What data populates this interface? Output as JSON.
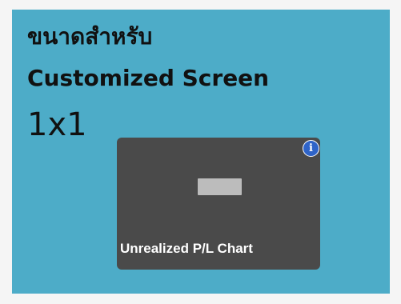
{
  "panel": {
    "title_line1": "ขนาดสำหรับ",
    "title_line2": "Customized Screen",
    "size_label": "1x1"
  },
  "widget": {
    "label": "Unrealized P/L Chart",
    "icon": "widget-placeholder-icon",
    "info_badge": {
      "icon": "info-icon",
      "glyph": "i",
      "color": "#2f64c8"
    }
  },
  "colors": {
    "panel_background": "#4dacc8",
    "tile_background": "#4a4a4a"
  }
}
